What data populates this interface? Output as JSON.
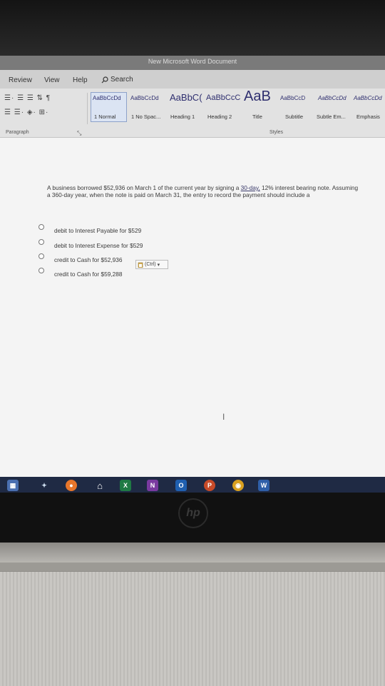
{
  "window": {
    "title": "New Microsoft Word Document"
  },
  "menu": {
    "items": [
      "Review",
      "View",
      "Help"
    ],
    "search_label": "Search"
  },
  "ribbon": {
    "paragraph_row1": "☰· ☰ ☰ ⇅ ¶",
    "paragraph_row2": "☰ ☰· ◈· ⊞·",
    "paragraph_label": "Paragraph",
    "styles_label": "Styles",
    "styles": [
      {
        "preview": "AaBbCcDd",
        "caption": "1 Normal"
      },
      {
        "preview": "AaBbCcDd",
        "caption": "1 No Spac..."
      },
      {
        "preview": "AaBbC(",
        "caption": "Heading 1"
      },
      {
        "preview": "AaBbCcC",
        "caption": "Heading 2"
      },
      {
        "preview": "AaB",
        "caption": "Title"
      },
      {
        "preview": "AaBbCcD",
        "caption": "Subtitle"
      },
      {
        "preview": "AaBbCcDd",
        "caption": "Subtle Em..."
      },
      {
        "preview": "AaBbCcDd",
        "caption": "Emphasis"
      }
    ]
  },
  "document": {
    "question_part1": "A business borrowed $52,936 on March 1 of the current year by signing a ",
    "question_link": "30-day,",
    "question_part2": " 12% interest bearing note. Assuming a 360-day year, when the note is paid on March 31, the entry to record the payment should include a",
    "options": [
      "debit to Interest Payable for $529",
      "debit to Interest Expense for $529",
      "credit to Cash for $52,936",
      "credit to Cash for $59,288"
    ],
    "paste_options_label": "(Ctrl)"
  },
  "device": {
    "brand": "hp"
  },
  "taskbar": {
    "icons": [
      "start-icon",
      "task-view-icon",
      "firefox-icon",
      "home-icon",
      "excel-icon",
      "onenote-icon",
      "outlook-icon",
      "powerpoint-icon",
      "chrome-icon",
      "word-icon"
    ]
  }
}
